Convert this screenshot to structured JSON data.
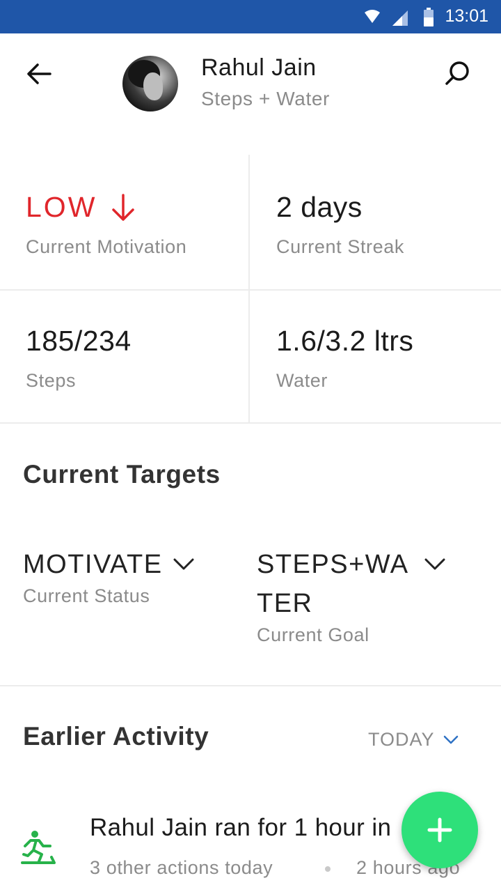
{
  "status_bar": {
    "time": "13:01",
    "icons": [
      "wifi-icon",
      "signal-icon",
      "battery-icon"
    ],
    "bg_color": "#1f56a8"
  },
  "header": {
    "name": "Rahul Jain",
    "subtitle": "Steps + Water",
    "icons": {
      "back": "back-arrow-icon",
      "search": "search-icon"
    }
  },
  "stats": {
    "motivation": {
      "value": "LOW",
      "label": "Current Motivation",
      "trend": "down",
      "color": "#e0262b"
    },
    "streak": {
      "value": "2 days",
      "label": "Current Streak"
    },
    "steps": {
      "value": "185/234",
      "label": "Steps"
    },
    "water": {
      "value": "1.6/3.2 ltrs",
      "label": "Water"
    }
  },
  "targets": {
    "title": "Current Targets",
    "status": {
      "value": "MOTIVATE",
      "label": "Current Status"
    },
    "goal": {
      "value_line1": "STEPS+WA",
      "value_line2": "TER",
      "label": "Current Goal"
    }
  },
  "activity": {
    "title": "Earlier Activity",
    "filter": "TODAY",
    "items": [
      {
        "icon": "running-icon",
        "title": "Rahul Jain ran for 1 hour in",
        "meta": "3 other actions today",
        "time": "2 hours ago"
      }
    ]
  },
  "fab": {
    "icon": "plus-icon",
    "color": "#2ee07a"
  }
}
